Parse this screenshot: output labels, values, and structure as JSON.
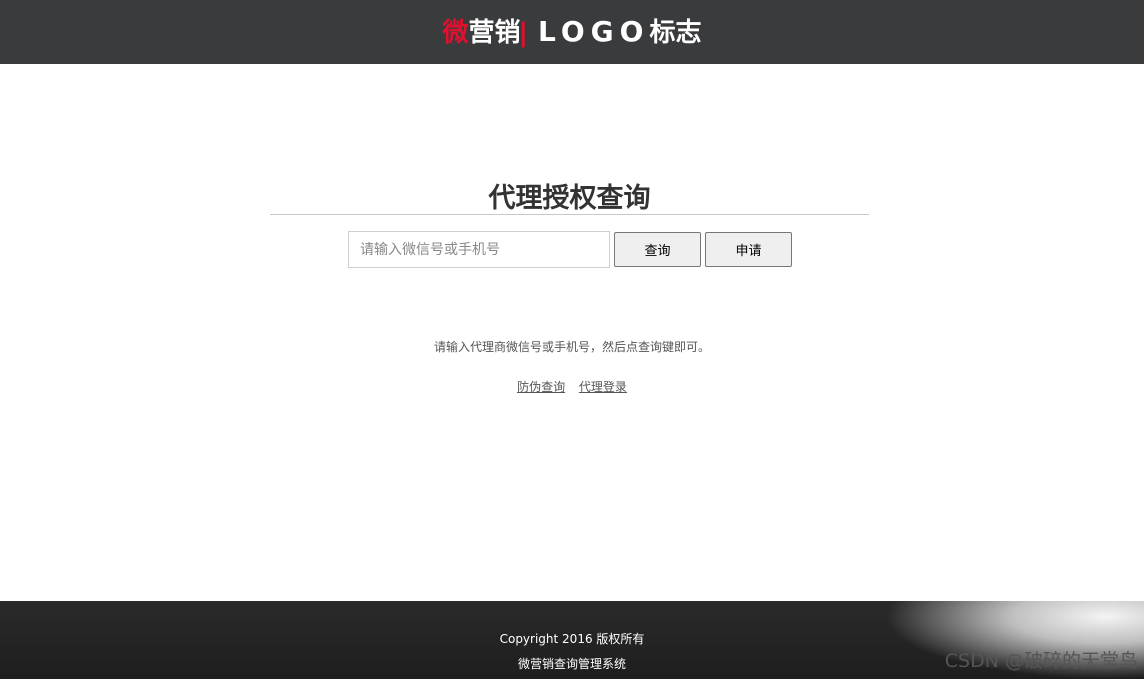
{
  "header": {
    "logo_part1": "微",
    "logo_part2": "营销",
    "logo_separator": "|",
    "logo_part3": "LOGO",
    "logo_part4": "标志"
  },
  "main": {
    "title": "代理授权查询",
    "search": {
      "placeholder": "请输入微信号或手机号",
      "value": ""
    },
    "query_button": "查询",
    "apply_button": "申请",
    "hint": "请输入代理商微信号或手机号，然后点查询键即可。",
    "links": {
      "anti_fake": "防伪查询",
      "agent_login": "代理登录"
    }
  },
  "footer": {
    "copyright": "Copyright 2016 版权所有",
    "system_name": "微营销查询管理系统"
  },
  "watermark": "CSDN @破碎的天堂鸟",
  "colors": {
    "header_bg": "#3a3b3d",
    "logo_accent": "#e0102f",
    "footer_bg": "#232323"
  }
}
